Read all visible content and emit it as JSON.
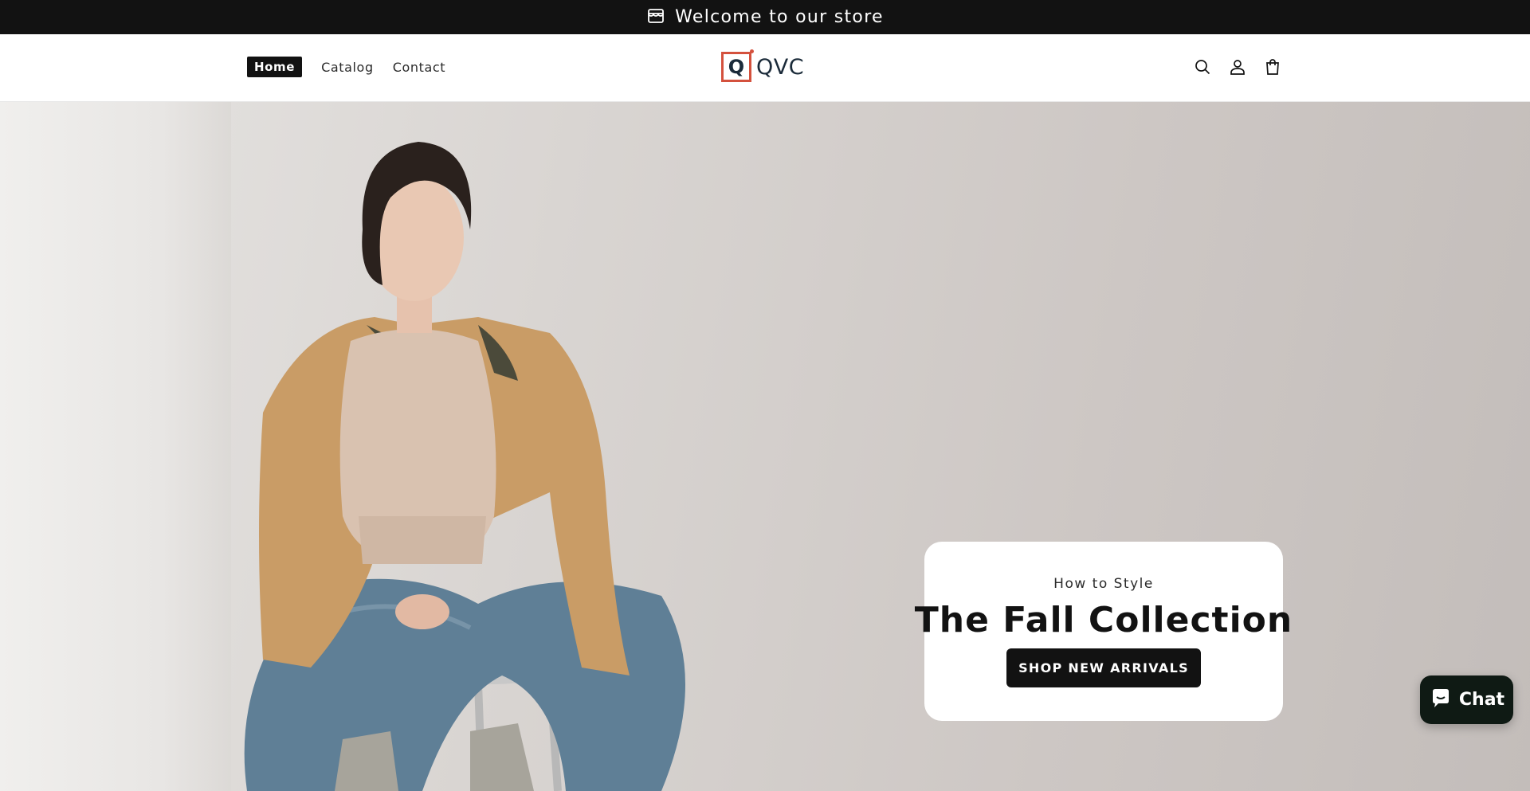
{
  "announcement": {
    "text": "Welcome to our store",
    "icon": "store-icon"
  },
  "header": {
    "nav": [
      {
        "label": "Home",
        "active": true
      },
      {
        "label": "Catalog",
        "active": false
      },
      {
        "label": "Contact",
        "active": false
      }
    ],
    "logo": {
      "mark": "Q",
      "text": "QVC"
    },
    "icons": [
      "search-icon",
      "account-icon",
      "cart-icon"
    ]
  },
  "hero": {
    "subheading": "How to Style",
    "heading": "The Fall Collection",
    "button_label": "SHOP NEW ARRIVALS"
  },
  "chat": {
    "label": "Chat",
    "icon": "chat-bubble-icon"
  },
  "colors": {
    "dark": "#121212",
    "accent": "#d4513d",
    "logo_navy": "#1b2b3a",
    "chat_bg": "#0f1a14"
  }
}
